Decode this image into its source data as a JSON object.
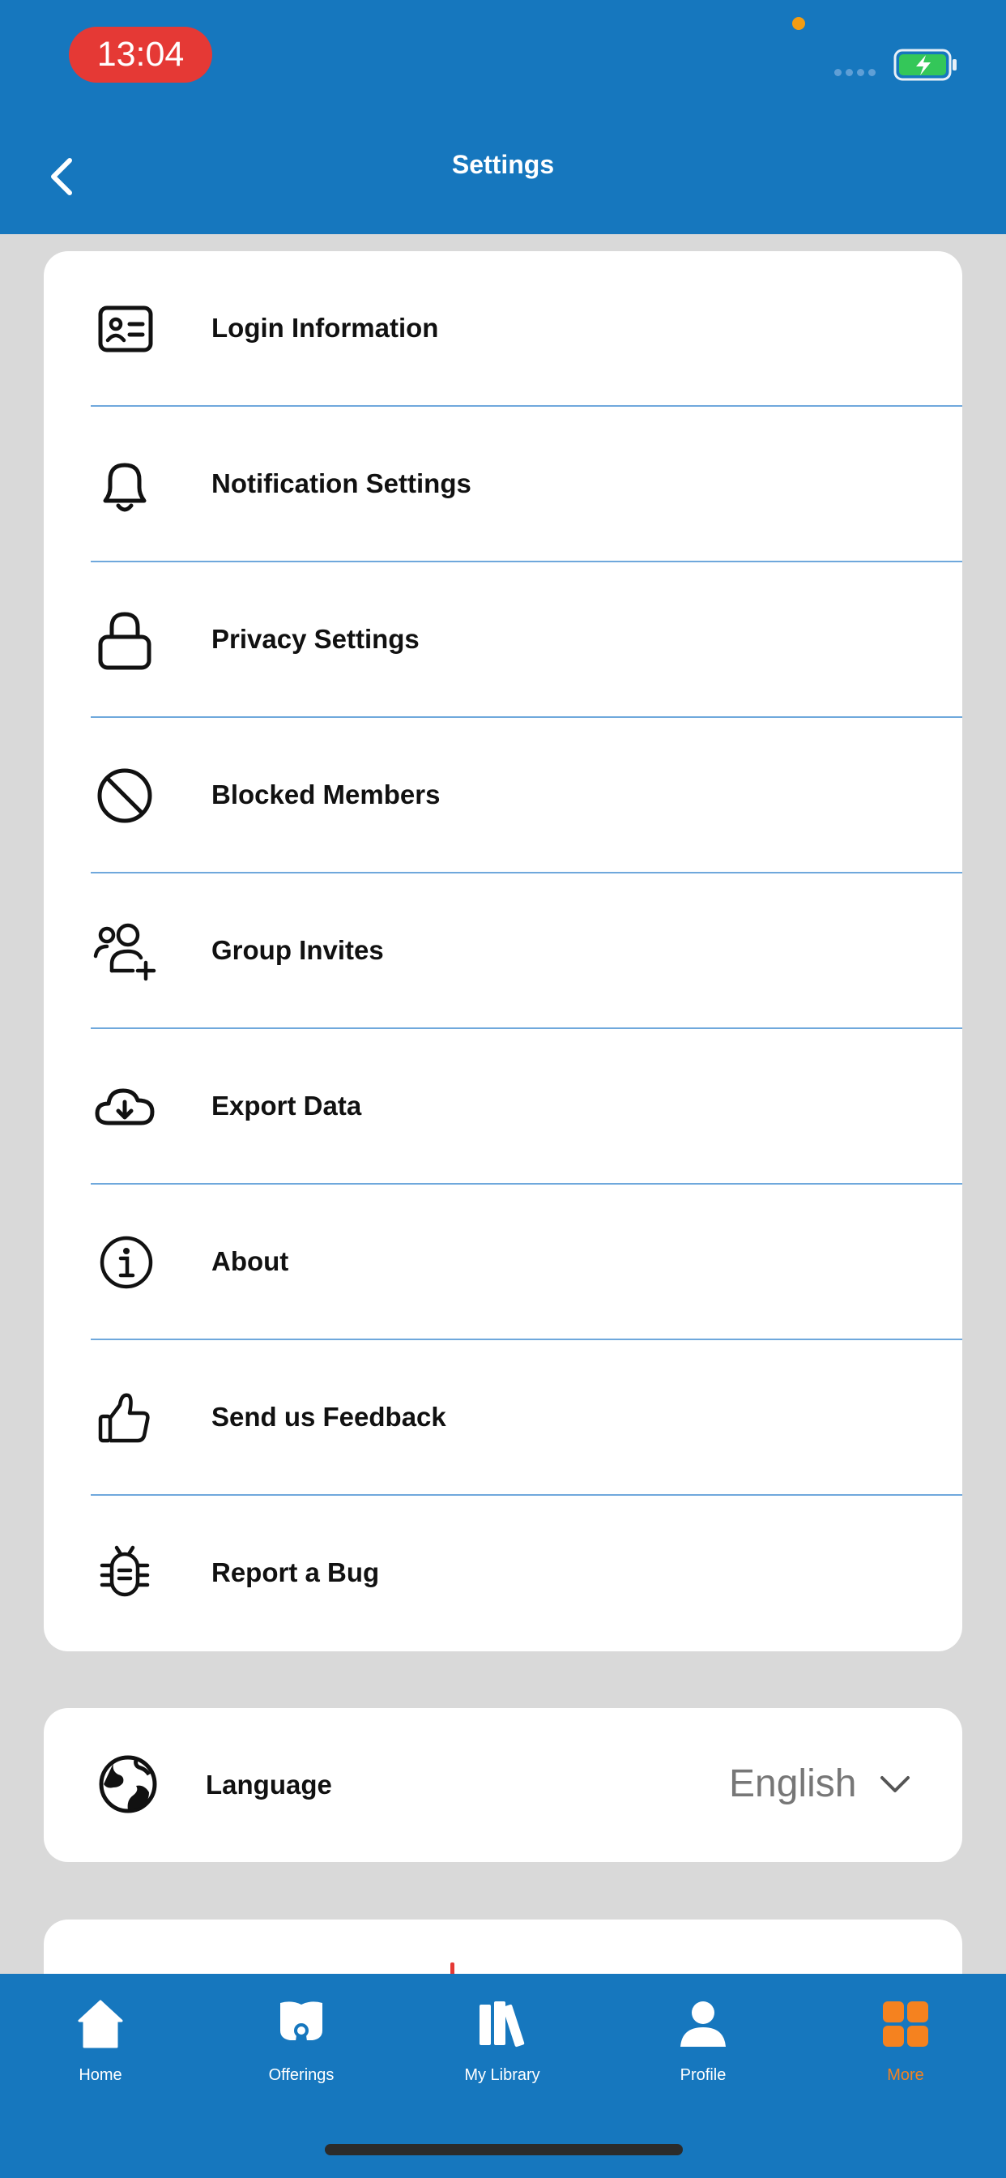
{
  "status_bar": {
    "time": "13:04"
  },
  "header": {
    "title": "Settings"
  },
  "menu": [
    {
      "label": "Login Information",
      "icon": "id-card-icon"
    },
    {
      "label": "Notification Settings",
      "icon": "bell-icon"
    },
    {
      "label": "Privacy Settings",
      "icon": "lock-icon"
    },
    {
      "label": "Blocked Members",
      "icon": "blocked-icon"
    },
    {
      "label": "Group Invites",
      "icon": "group-add-icon"
    },
    {
      "label": "Export Data",
      "icon": "cloud-download-icon"
    },
    {
      "label": "About",
      "icon": "info-icon"
    },
    {
      "label": "Send us Feedback",
      "icon": "thumbs-up-icon"
    },
    {
      "label": "Report a Bug",
      "icon": "bug-icon"
    }
  ],
  "language": {
    "label": "Language",
    "value": "English",
    "icon": "globe-icon"
  },
  "tabs": [
    {
      "label": "Home",
      "icon": "home-icon"
    },
    {
      "label": "Offerings",
      "icon": "offerings-icon"
    },
    {
      "label": "My Library",
      "icon": "library-icon"
    },
    {
      "label": "Profile",
      "icon": "profile-icon"
    },
    {
      "label": "More",
      "icon": "grid-icon",
      "active": true
    }
  ],
  "colors": {
    "brand": "#1677be",
    "accent": "#f5821f",
    "divider": "#6fa8dc",
    "time_pill": "#e53935"
  }
}
